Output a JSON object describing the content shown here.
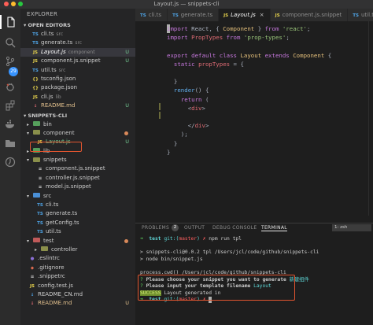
{
  "window": {
    "title": "Layout.js — snippets-cli"
  },
  "sidebar": {
    "header": "EXPLORER",
    "open_editors_label": "OPEN EDITORS",
    "open_editors": [
      {
        "icon": "TS",
        "icon_color": "#4fa5e8",
        "name": "cli.ts",
        "desc": "src",
        "status": "",
        "selected": false,
        "name_color": "#cccccc"
      },
      {
        "icon": "TS",
        "icon_color": "#4fa5e8",
        "name": "generate.ts",
        "desc": "src",
        "status": "",
        "selected": false,
        "name_color": "#cccccc"
      },
      {
        "icon": "JS",
        "icon_color": "#e8d44d",
        "name": "Layout.js",
        "desc": "component",
        "status": "U",
        "selected": true,
        "name_color": "#ffffff"
      },
      {
        "icon": "JS",
        "icon_color": "#e8d44d",
        "name": "component.js.snippet",
        "desc": "",
        "status": "U",
        "selected": false,
        "name_color": "#cccccc"
      },
      {
        "icon": "TS",
        "icon_color": "#4fa5e8",
        "name": "util.ts",
        "desc": "src",
        "status": "",
        "selected": false,
        "name_color": "#cccccc"
      },
      {
        "icon": "{}",
        "icon_color": "#e8d44d",
        "name": "tsconfig.json",
        "desc": "",
        "status": "",
        "selected": false,
        "name_color": "#cccccc"
      },
      {
        "icon": "{}",
        "icon_color": "#e8d44d",
        "name": "package.json",
        "desc": "",
        "status": "",
        "selected": false,
        "name_color": "#cccccc"
      },
      {
        "icon": "JS",
        "icon_color": "#e8d44d",
        "name": "cli.js",
        "desc": "lib",
        "status": "",
        "selected": false,
        "name_color": "#cccccc"
      },
      {
        "icon": "↓",
        "icon_color": "#e06c75",
        "name": "README.md",
        "desc": "",
        "status": "U",
        "selected": false,
        "name_color": "#e2c08d"
      }
    ],
    "project_label": "SNIPPETS-CLI",
    "tree": [
      {
        "type": "folder",
        "indent": 0,
        "name": "bin",
        "color": "green",
        "status": "",
        "name_color": "#cccccc"
      },
      {
        "type": "folder-open",
        "indent": 0,
        "name": "component",
        "color": "yellow",
        "status": "dot",
        "name_color": "#cccccc"
      },
      {
        "type": "file",
        "indent": 1,
        "icon": "JS",
        "icon_color": "#e8d44d",
        "name": "Layout.js",
        "status": "U",
        "name_color": "#73c991"
      },
      {
        "type": "folder",
        "indent": 0,
        "name": "lib",
        "color": "green",
        "status": "",
        "name_color": "#cccccc"
      },
      {
        "type": "folder-open",
        "indent": 0,
        "name": "snippets",
        "color": "yellow",
        "status": "",
        "name_color": "#cccccc"
      },
      {
        "type": "file",
        "indent": 1,
        "icon": "≡",
        "icon_color": "#cccccc",
        "name": "component.js.snippet",
        "status": "",
        "name_color": "#cccccc"
      },
      {
        "type": "file",
        "indent": 1,
        "icon": "≡",
        "icon_color": "#cccccc",
        "name": "controller.js.snippet",
        "status": "",
        "name_color": "#cccccc"
      },
      {
        "type": "file",
        "indent": 1,
        "icon": "≡",
        "icon_color": "#cccccc",
        "name": "model.js.snippet",
        "status": "",
        "name_color": "#cccccc"
      },
      {
        "type": "folder-open",
        "indent": 0,
        "name": "src",
        "color": "blue",
        "status": "",
        "name_color": "#cccccc"
      },
      {
        "type": "file",
        "indent": 1,
        "icon": "TS",
        "icon_color": "#4fa5e8",
        "name": "cli.ts",
        "status": "",
        "name_color": "#cccccc"
      },
      {
        "type": "file",
        "indent": 1,
        "icon": "TS",
        "icon_color": "#4fa5e8",
        "name": "generate.ts",
        "status": "",
        "name_color": "#cccccc"
      },
      {
        "type": "file",
        "indent": 1,
        "icon": "TS",
        "icon_color": "#4fa5e8",
        "name": "getConfig.ts",
        "status": "",
        "name_color": "#cccccc"
      },
      {
        "type": "file",
        "indent": 1,
        "icon": "TS",
        "icon_color": "#4fa5e8",
        "name": "util.ts",
        "status": "",
        "name_color": "#cccccc"
      },
      {
        "type": "folder-open",
        "indent": 0,
        "name": "test",
        "color": "red",
        "status": "dot",
        "name_color": "#cccccc"
      },
      {
        "type": "folder",
        "indent": 1,
        "name": "controller",
        "color": "yellow",
        "status": "",
        "name_color": "#cccccc"
      },
      {
        "type": "file",
        "indent": 0,
        "icon": "●",
        "icon_color": "#8b6fd6",
        "name": ".eslintrc",
        "status": "",
        "name_color": "#cccccc"
      },
      {
        "type": "file",
        "indent": 0,
        "icon": "◆",
        "icon_color": "#e06c50",
        "name": ".gitignore",
        "status": "",
        "name_color": "#cccccc"
      },
      {
        "type": "file",
        "indent": 0,
        "icon": "≡",
        "icon_color": "#cccccc",
        "name": ".snippetrc",
        "status": "",
        "name_color": "#cccccc"
      },
      {
        "type": "file",
        "indent": 0,
        "icon": "JS",
        "icon_color": "#e8d44d",
        "name": "config.test.js",
        "status": "",
        "name_color": "#cccccc"
      },
      {
        "type": "file",
        "indent": 0,
        "icon": "↓",
        "icon_color": "#4fa5e8",
        "name": "README_CN.md",
        "status": "",
        "name_color": "#cccccc"
      },
      {
        "type": "file",
        "indent": 0,
        "icon": "↓",
        "icon_color": "#e06c75",
        "name": "README.md",
        "status": "U",
        "name_color": "#e2c08d"
      }
    ]
  },
  "activity": {
    "scm_badge": "29"
  },
  "tabs": [
    {
      "kind": "TS",
      "label": "cli.ts",
      "active": false,
      "close": ""
    },
    {
      "kind": "TS",
      "label": "generate.ts",
      "active": false,
      "close": ""
    },
    {
      "kind": "JS",
      "label": "Layout.js",
      "active": true,
      "close": "×"
    },
    {
      "kind": "JS",
      "label": "component.js.snippet",
      "active": false,
      "close": ""
    },
    {
      "kind": "TS",
      "label": "util.ts",
      "active": false,
      "close": ""
    }
  ],
  "code": [
    [
      [
        "cursor",
        "i"
      ],
      [
        "kw",
        "mport "
      ],
      [
        "plain",
        "React, { "
      ],
      [
        "cls",
        "Component"
      ],
      [
        "plain",
        " } "
      ],
      [
        "kw",
        "from "
      ],
      [
        "str",
        "'react'"
      ],
      [
        "plain",
        ";"
      ]
    ],
    [
      [
        "kw",
        "import "
      ],
      [
        "tag",
        "PropTypes"
      ],
      [
        "kw",
        " from "
      ],
      [
        "str",
        "'prop-types'"
      ],
      [
        "plain",
        ";"
      ]
    ],
    [],
    [
      [
        "kw",
        "export default class "
      ],
      [
        "cls",
        "Layout "
      ],
      [
        "kw",
        "extends "
      ],
      [
        "cls",
        "Component"
      ],
      [
        "plain",
        " {"
      ]
    ],
    [
      [
        "plain",
        "  "
      ],
      [
        "kw",
        "static "
      ],
      [
        "prop",
        "propTypes"
      ],
      [
        "plain",
        " = {"
      ]
    ],
    [],
    [
      [
        "plain",
        "  }"
      ]
    ],
    [
      [
        "plain",
        "  "
      ],
      [
        "fn",
        "render"
      ],
      [
        "plain",
        "() {"
      ]
    ],
    [
      [
        "plain",
        "    "
      ],
      [
        "kw",
        "return"
      ],
      [
        "plain",
        " ("
      ]
    ],
    [
      [
        "plain",
        "      <"
      ],
      [
        "tag",
        "div"
      ],
      [
        "plain",
        ">"
      ]
    ],
    [],
    [
      [
        "plain",
        "      </"
      ],
      [
        "tag",
        "div"
      ],
      [
        "plain",
        ">"
      ]
    ],
    [
      [
        "plain",
        "    );"
      ]
    ],
    [
      [
        "plain",
        "  }"
      ]
    ],
    [
      [
        "plain",
        "}"
      ]
    ]
  ],
  "panel": {
    "tabs": [
      "PROBLEMS",
      "OUTPUT",
      "DEBUG CONSOLE",
      "TERMINAL"
    ],
    "active_tab": "TERMINAL",
    "problems_count": "2",
    "shell": "1: zsh"
  },
  "terminal": [
    [
      [
        "green bold",
        "➜  "
      ],
      [
        "cyan bold",
        "test "
      ],
      [
        "cyan",
        "git:("
      ],
      [
        "red",
        "master"
      ],
      [
        "cyan",
        ") "
      ],
      [
        "red",
        "✗ "
      ],
      [
        "plain",
        "npm run tpl"
      ]
    ],
    [],
    [
      [
        "plain",
        "> snippets-cli@0.0.2 tpl /Users/jcl/code/github/snippets-cli"
      ]
    ],
    [
      [
        "plain",
        "> node bin/snippet.js"
      ]
    ],
    [],
    [
      [
        "plain",
        "process.cwd() /Users/jcl/code/github/snippets-cli"
      ]
    ],
    [
      [
        "green",
        "? "
      ],
      [
        "bold",
        "Please choose your snippet you want to generate "
      ],
      [
        "cyan",
        "新建组件"
      ]
    ],
    [
      [
        "green",
        "? "
      ],
      [
        "bold",
        "Please input your template filename "
      ],
      [
        "cyan",
        "Layout"
      ]
    ],
    [
      [
        "yellowbg",
        "SUCCESS"
      ],
      [
        "plain",
        " Layout generated in"
      ]
    ],
    [
      [
        "green bold",
        "➜  "
      ],
      [
        "cyan bold",
        "test "
      ],
      [
        "cyan",
        "git:("
      ],
      [
        "red",
        "master"
      ],
      [
        "cyan",
        ") "
      ],
      [
        "red",
        "✗ "
      ],
      [
        "cursor",
        " "
      ]
    ]
  ]
}
